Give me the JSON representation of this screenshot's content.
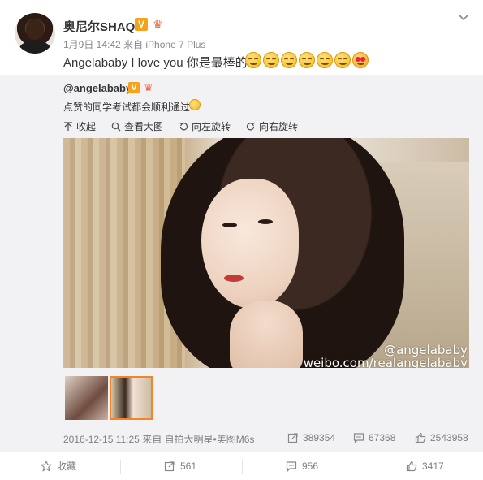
{
  "post": {
    "username": "奥尼尔SHAQ",
    "verified_badge": "V",
    "meta": "1月9日 14:42 来自 iPhone 7 Plus",
    "text": "Angelababy I love you 你是最棒的!",
    "emoji_icons": [
      "grin-emoji-icon",
      "grin-emoji-icon",
      "grin-emoji-icon",
      "grin-emoji-icon",
      "grin-emoji-icon",
      "grin-emoji-icon",
      "heart-eyes-emoji-icon"
    ]
  },
  "retweet": {
    "author": "@angelababy",
    "verified_badge": "V",
    "text": "点赞的同学考试都会顺利通过",
    "tools": {
      "collapse": "收起",
      "view_large": "查看大图",
      "rotate_left": "向左旋转",
      "rotate_right": "向右旋转"
    },
    "watermark_handle": "@angelababy",
    "watermark_url": "weibo.com/realangelababy",
    "footer_meta": "2016-12-15 11:25 来自 自拍大明星•美图M6s",
    "stats": {
      "reposts": "389354",
      "comments": "67368",
      "likes": "2543958"
    }
  },
  "actions": {
    "favorite": "收藏",
    "repost": "561",
    "comment": "956",
    "like": "3417"
  },
  "colors": {
    "badge_orange": "#f7a21b",
    "thumb_selected_border": "#f5832a",
    "retweet_bg": "#f2f2f5"
  }
}
